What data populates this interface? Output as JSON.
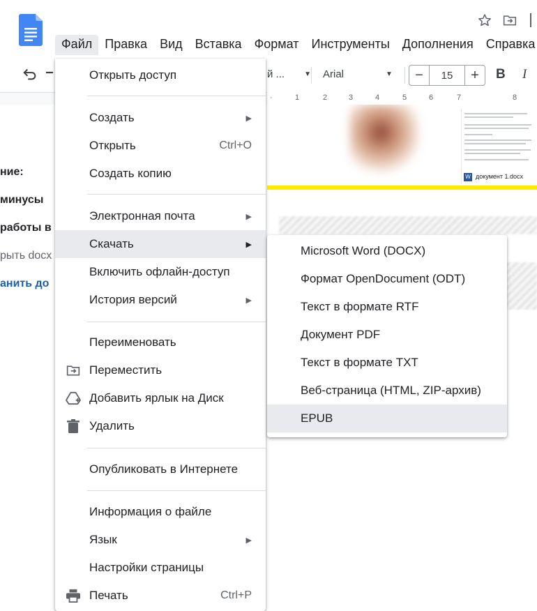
{
  "menubar": {
    "items": [
      "Файл",
      "Правка",
      "Вид",
      "Вставка",
      "Формат",
      "Инструменты",
      "Дополнения",
      "Справка"
    ]
  },
  "toolbar": {
    "style_value": "й ...",
    "font_value": "Arial",
    "font_size": "15",
    "bold_label": "B",
    "italic_label": "I"
  },
  "ruler": {
    "ticks": [
      "1",
      "2",
      "3",
      "4",
      "5",
      "6",
      "7",
      "8"
    ]
  },
  "document": {
    "outline": [
      "ние:",
      "минусы",
      "работы в",
      "рыть docx",
      "анить до"
    ],
    "thumbnail_title": "документ 1.docx",
    "thumbnail_badge": "W"
  },
  "file_menu": {
    "share": "Открыть доступ",
    "create": "Создать",
    "open": "Открыть",
    "open_shortcut": "Ctrl+O",
    "copy": "Создать копию",
    "email": "Электронная почта",
    "download": "Скачать",
    "offline": "Включить офлайн-доступ",
    "history": "История версий",
    "rename": "Переименовать",
    "move": "Переместить",
    "shortcut_drive": "Добавить ярлык на Диск",
    "delete": "Удалить",
    "publish": "Опубликовать в Интернете",
    "info": "Информация о файле",
    "language": "Язык",
    "page_setup": "Настройки страницы",
    "print": "Печать",
    "print_shortcut": "Ctrl+P"
  },
  "download_menu": {
    "items": [
      "Microsoft Word (DOCX)",
      "Формат OpenDocument (ODT)",
      "Текст в формате RTF",
      "Документ PDF",
      "Текст в формате TXT",
      "Веб-страница (HTML, ZIP-архив)",
      "EPUB"
    ]
  },
  "icons": {
    "app": "docs-logo-icon",
    "star": "star-icon",
    "move": "move-to-folder-icon",
    "undo": "undo-icon",
    "redo": "redo-icon",
    "menu_move": "folder-move-icon",
    "menu_drive": "add-to-drive-icon",
    "menu_delete": "trash-icon",
    "menu_print": "printer-icon"
  },
  "colors": {
    "docs_blue": "#4285f4",
    "highlight": "#e8eaed",
    "yellow_rule": "#ffeb00",
    "link_blue": "#1a5fa8"
  }
}
